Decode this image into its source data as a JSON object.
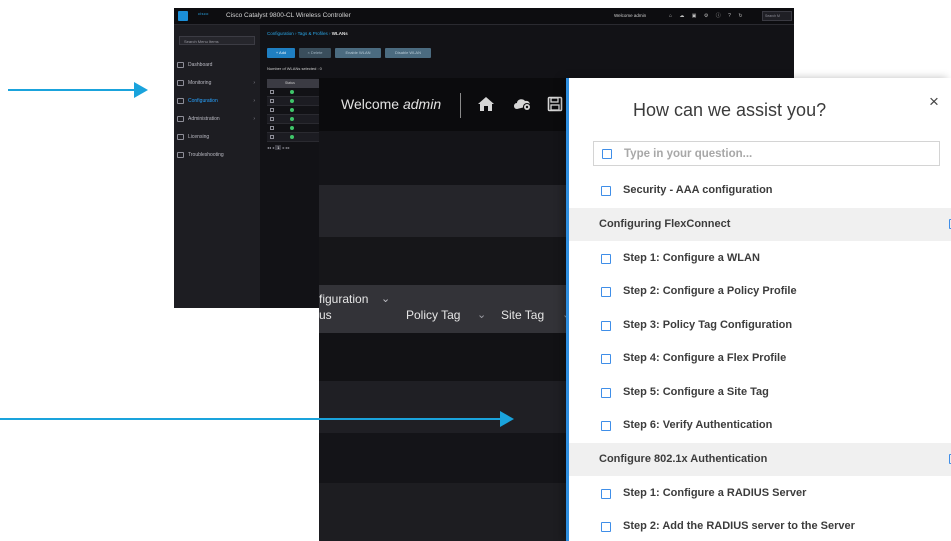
{
  "mini": {
    "cisco": "cisco",
    "title": "Cisco Catalyst 9800-CL Wireless Controller",
    "welcome": "Welcome admin",
    "search": "Search M",
    "icons": [
      "home-icon",
      "cloud-icon",
      "save-icon",
      "gear-icon",
      "info-icon",
      "help-icon",
      "refresh-icon"
    ],
    "side_search": "Search Menu Items",
    "nav": [
      {
        "label": "Dashboard",
        "icon": "dashboard-icon",
        "chevron": false
      },
      {
        "label": "Monitoring",
        "icon": "monitoring-icon",
        "chevron": true
      },
      {
        "label": "Configuration",
        "icon": "configuration-icon",
        "chevron": true
      },
      {
        "label": "Administration",
        "icon": "administration-icon",
        "chevron": true
      },
      {
        "label": "Licensing",
        "icon": "licensing-icon",
        "chevron": false
      },
      {
        "label": "Troubleshooting",
        "icon": "troubleshooting-icon",
        "chevron": false
      }
    ],
    "breadcrumb": "Configuration › Tags & Profiles › ",
    "breadcrumb_current": "WLANs",
    "buttons": [
      "+ Add",
      "× Delete",
      "Enable WLAN",
      "Disable WLAN"
    ],
    "count": "Number of WLANs selected : 0",
    "table_header": "Status",
    "pager_current": "1"
  },
  "big": {
    "welcome": "Welcome ",
    "user": "admin",
    "col_configuration": "figuration",
    "col_status": "us",
    "col_policy_tag": "Policy Tag",
    "col_site_tag": "Site Tag"
  },
  "panel": {
    "title": "How can we assist you?",
    "close": "×",
    "search_placeholder": "Type in your question...",
    "items": [
      {
        "type": "link",
        "label": "Security - AAA configuration"
      },
      {
        "type": "section",
        "label": "Configuring FlexConnect"
      },
      {
        "type": "link",
        "label": "Step 1: Configure a WLAN"
      },
      {
        "type": "link",
        "label": "Step 2: Configure a Policy Profile"
      },
      {
        "type": "link",
        "label": "Step 3: Policy Tag Configuration"
      },
      {
        "type": "link",
        "label": "Step 4: Configure a Flex Profile"
      },
      {
        "type": "link",
        "label": "Step 5: Configure a Site Tag"
      },
      {
        "type": "link",
        "label": "Step 6: Verify Authentication"
      },
      {
        "type": "section",
        "label": "Configure 802.1x Authentication"
      },
      {
        "type": "link",
        "label": "Step 1: Configure a RADIUS Server"
      },
      {
        "type": "link",
        "label": "Step 2: Add the RADIUS server to the Server"
      }
    ]
  },
  "colors": {
    "arrow": "#1aa3dc",
    "panel_border": "#2f8fe0",
    "checkbox": "#3f8ee8",
    "active_nav": "#28a3ff"
  }
}
